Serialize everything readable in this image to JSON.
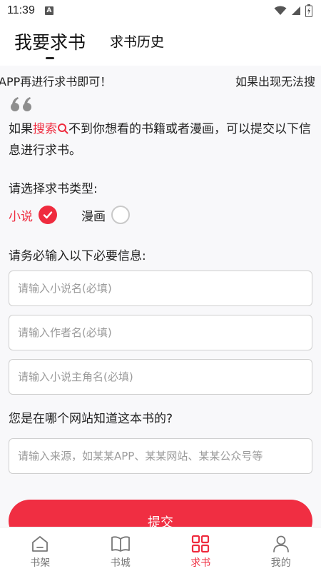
{
  "status_bar": {
    "time": "11:39",
    "a_badge": "A"
  },
  "header": {
    "tabs": [
      {
        "label": "我要求书",
        "active": true
      },
      {
        "label": "求书历史",
        "active": false
      }
    ]
  },
  "marquee": {
    "segment_a": "APP再进行求书即可！",
    "segment_b": "如果出现无法搜"
  },
  "intro": {
    "part1": "如果",
    "search_word": "搜索",
    "part2": "不到你想看的书籍或者漫画，可以提交以下信息进行求书。"
  },
  "type_section": {
    "label": "请选择求书类型:",
    "options": [
      {
        "label": "小说",
        "selected": true
      },
      {
        "label": "漫画",
        "selected": false
      }
    ]
  },
  "required_section": {
    "label": "请务必输入以下必要信息:",
    "fields": [
      {
        "placeholder": "请输入小说名(必填)",
        "value": ""
      },
      {
        "placeholder": "请输入作者名(必填)",
        "value": ""
      },
      {
        "placeholder": "请输入小说主角名(必填)",
        "value": ""
      }
    ]
  },
  "source_section": {
    "label": "您是在哪个网站知道这本书的?",
    "placeholder": "请输入来源，如某某APP、某某网站、某某公众号等",
    "value": ""
  },
  "submit_label": "提交",
  "bottom_nav": [
    {
      "label": "书架",
      "icon": "home-icon",
      "active": false
    },
    {
      "label": "书城",
      "icon": "book-icon",
      "active": false
    },
    {
      "label": "求书",
      "icon": "grid-icon",
      "active": true
    },
    {
      "label": "我的",
      "icon": "user-icon",
      "active": false
    }
  ],
  "colors": {
    "accent": "#ef2b3e",
    "background": "#f8f8fa"
  }
}
